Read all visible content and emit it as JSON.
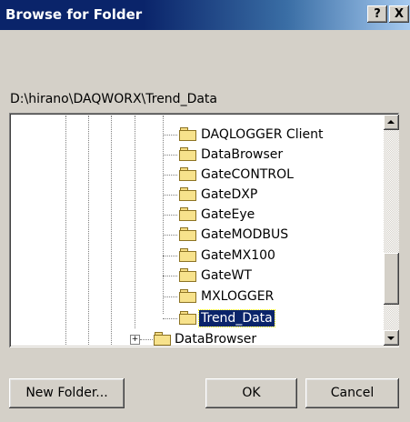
{
  "window": {
    "title": "Browse for Folder",
    "help_label": "?",
    "close_label": "X"
  },
  "path_label": "D:\\hirano\\DAQWORX\\Trend_Data",
  "tree": {
    "children": [
      {
        "label": "DAQLOGGER Client"
      },
      {
        "label": "DataBrowser"
      },
      {
        "label": "GateCONTROL"
      },
      {
        "label": "GateDXP"
      },
      {
        "label": "GateEye"
      },
      {
        "label": "GateMODBUS"
      },
      {
        "label": "GateMX100"
      },
      {
        "label": "GateWT"
      },
      {
        "label": "MXLOGGER"
      },
      {
        "label": "Trend_Data",
        "selected": true
      }
    ],
    "sibling": {
      "label": "DataBrowser",
      "expander": "+"
    }
  },
  "buttons": {
    "new_folder_label": "New Folder...",
    "ok_label": "OK",
    "cancel_label": "Cancel"
  },
  "colors": {
    "titlebar": "#0a246a",
    "selection": "#0a246a",
    "face": "#d4d0c8"
  }
}
